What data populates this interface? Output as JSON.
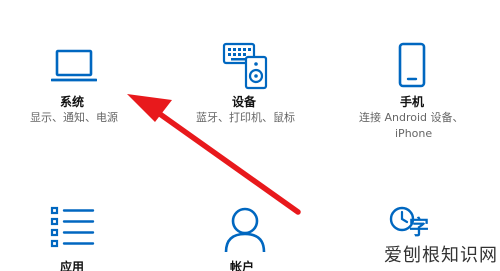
{
  "settings_tiles": {
    "system": {
      "title": "系统",
      "description": "显示、通知、电源",
      "icon": "laptop-icon"
    },
    "devices": {
      "title": "设备",
      "description": "蓝牙、打印机、鼠标",
      "icon": "keyboard-speaker-icon"
    },
    "phone": {
      "title": "手机",
      "description_line1": "连接 Android 设备、",
      "description_line2": "iPhone",
      "icon": "phone-icon"
    },
    "apps": {
      "title": "应用",
      "icon": "apps-list-icon"
    },
    "accounts": {
      "title": "帐户",
      "icon": "person-icon"
    },
    "time_language": {
      "glyph": "字",
      "icon": "time-language-icon"
    }
  },
  "watermark": {
    "text": "爱刨根知识网"
  },
  "colors": {
    "accent": "#0067C0",
    "annotation_arrow": "#E8191C"
  }
}
